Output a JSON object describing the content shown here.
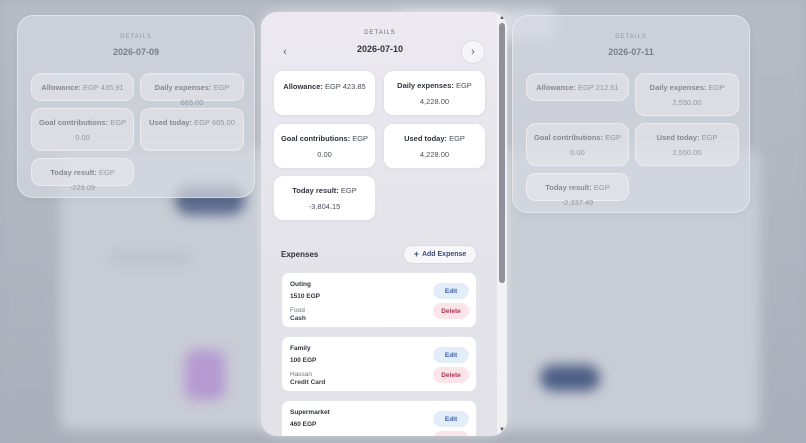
{
  "left_card": {
    "kicker": "DETAILS",
    "date": "2026-07-09",
    "allowance_label": "Allowance:",
    "allowance_value": "EGP 435.91",
    "daily_label": "Daily expenses:",
    "daily_value": "EGP 665.00",
    "goal_label": "Goal contributions:",
    "goal_value": "EGP 0.00",
    "used_label": "Used today:",
    "used_value": "EGP 665.00",
    "result_label": "Today result:",
    "result_value": "EGP -229.09"
  },
  "main_card": {
    "kicker": "DETAILS",
    "date": "2026-07-10",
    "prev_icon": "‹",
    "next_icon": "›",
    "allowance_label": "Allowance:",
    "allowance_value": "EGP 423.85",
    "daily_label": "Daily expenses:",
    "daily_value": "EGP 4,228.00",
    "goal_label": "Goal contributions:",
    "goal_value": "EGP 0.00",
    "used_label": "Used today:",
    "used_value": "EGP 4,228.00",
    "result_label": "Today result:",
    "result_value": "EGP -3,804.15",
    "expenses_title": "Expenses",
    "add_expense_label": "Add Expense",
    "edit_label": "Edit",
    "delete_label": "Delete",
    "expenses": [
      {
        "name": "Outing",
        "amount": "1510 EGP",
        "category": "Food",
        "method": "Cash"
      },
      {
        "name": "Family",
        "amount": "100 EGP",
        "category": "Hassan",
        "method": "Credit Card"
      },
      {
        "name": "Supermarket",
        "amount": "460 EGP",
        "category": "",
        "method": ""
      }
    ]
  },
  "right_card": {
    "kicker": "DETAILS",
    "date": "2026-07-11",
    "allowance_label": "Allowance:",
    "allowance_value": "EGP 212.51",
    "daily_label": "Daily expenses:",
    "daily_value": "EGP 2,550.00",
    "goal_label": "Goal contributions:",
    "goal_value": "EGP 0.00",
    "used_label": "Used today:",
    "used_value": "EGP 2,550.00",
    "result_label": "Today result:",
    "result_value": "EGP -2,337.49"
  }
}
